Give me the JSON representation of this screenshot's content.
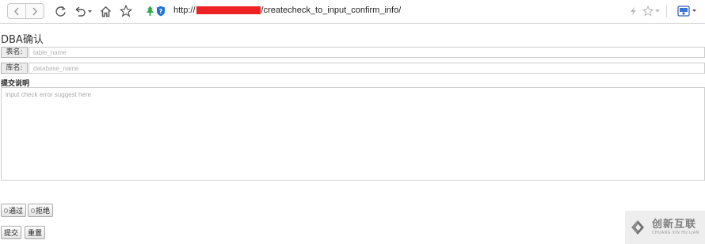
{
  "browser": {
    "url_prefix": "http://",
    "url_suffix": "/createcheck_to_input_confirm_info/"
  },
  "page": {
    "title": "DBA确认",
    "table_field": {
      "label": "表名:",
      "placeholder": "table_name"
    },
    "database_field": {
      "label": "库名:",
      "placeholder": "database_name"
    },
    "remark": {
      "label": "提交说明",
      "placeholder": "input check error suggest here"
    },
    "approval": {
      "approve_label": "通过",
      "reject_label": "拒绝"
    },
    "actions": {
      "submit_label": "提交",
      "reset_label": "重置"
    }
  },
  "watermark": {
    "cn": "创新互联",
    "en": "CHUANG XIN HU LIAN"
  },
  "colors": {
    "redaction": "#ee2222",
    "shield_blue": "#1e6fd9",
    "tree_green": "#2aa84a"
  }
}
